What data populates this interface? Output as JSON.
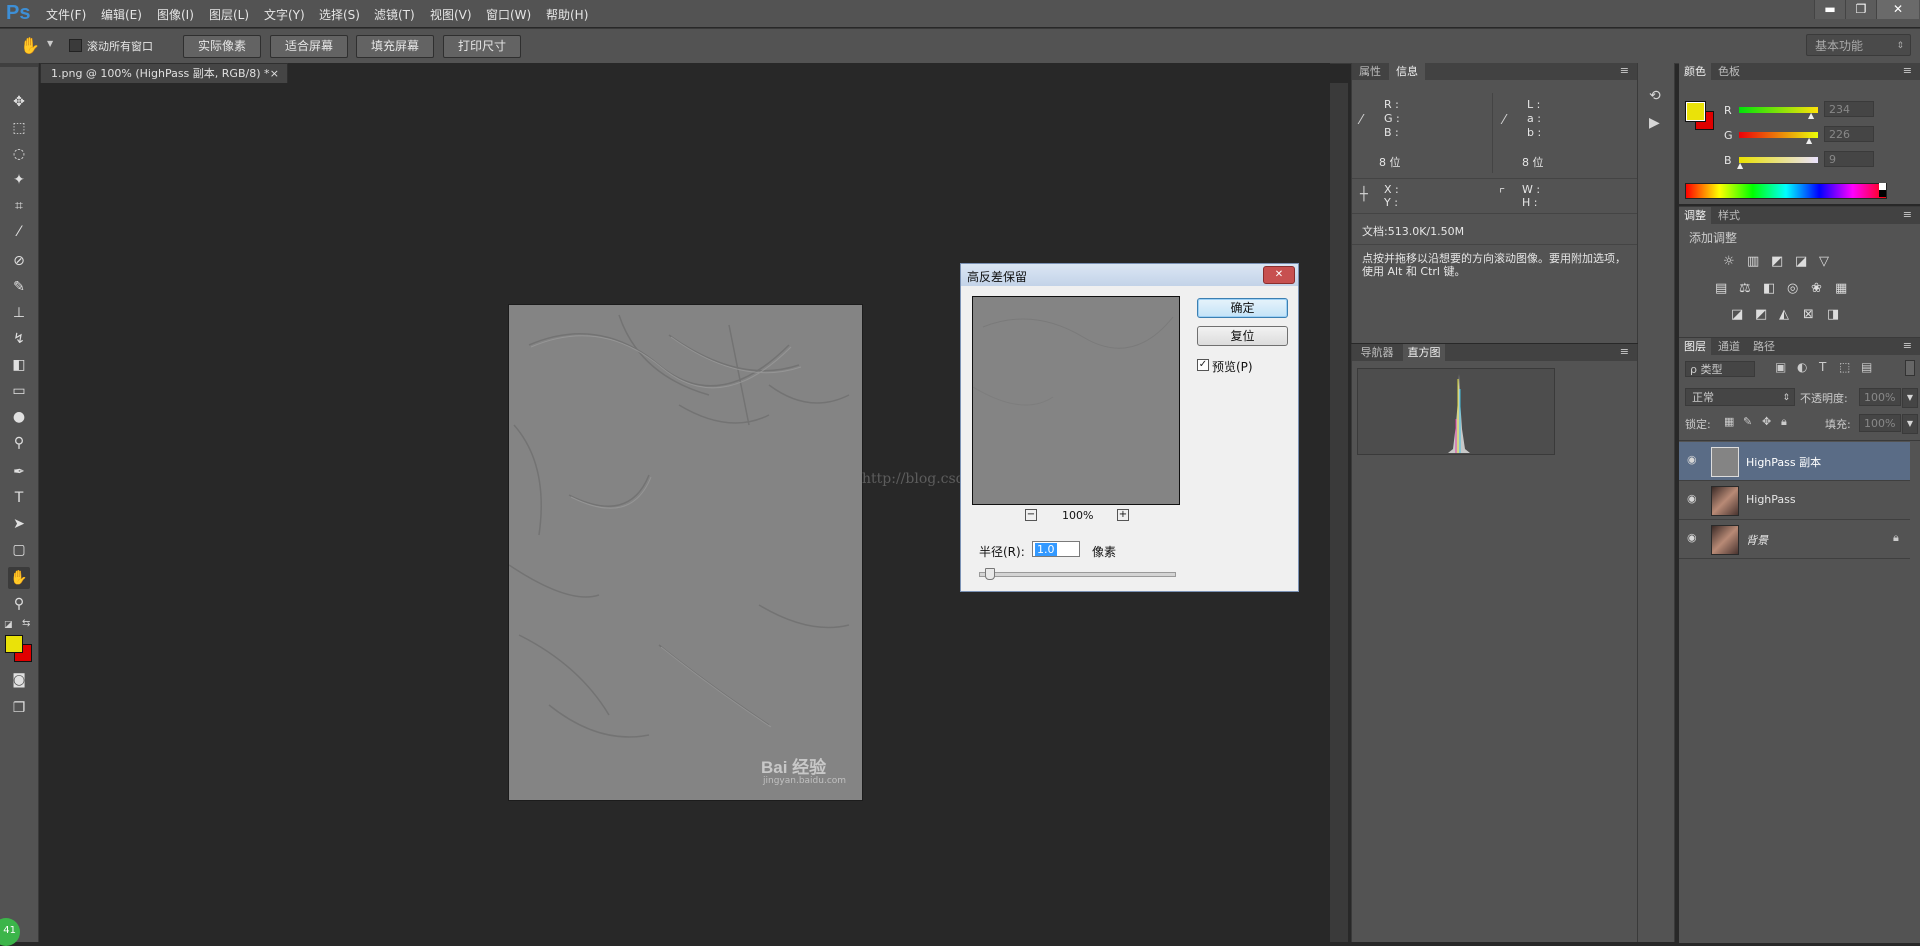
{
  "app": {
    "logo": "Ps"
  },
  "menu": [
    "文件(F)",
    "编辑(E)",
    "图像(I)",
    "图层(L)",
    "文字(Y)",
    "选择(S)",
    "滤镜(T)",
    "视图(V)",
    "窗口(W)",
    "帮助(H)"
  ],
  "window_controls": {
    "minimize": "▬",
    "restore": "❐",
    "close": "✕"
  },
  "options": {
    "scroll_all_label": "滚动所有窗口",
    "buttons": [
      "实际像素",
      "适合屏幕",
      "填充屏幕",
      "打印尺寸"
    ],
    "workspace": "基本功能"
  },
  "document_tab": {
    "title": "1.png @ 100% (HighPass 副本, RGB/8) *",
    "close": "×"
  },
  "watermark": {
    "logo": "Bai 经验",
    "url": "jingyan.baidu.com"
  },
  "blog_watermark": "http://blog.csdn.net/",
  "dialog": {
    "title": "高反差保留",
    "close": "✕",
    "ok": "确定",
    "reset": "复位",
    "preview_label": "预览(P)",
    "preview_checked": true,
    "zoom": "100%",
    "zoom_minus": "−",
    "zoom_plus": "+",
    "radius_label": "半径(R):",
    "radius_value": "1.0",
    "radius_unit": "像素",
    "radius_slider_level": 0.03
  },
  "info_panel": {
    "tabs": [
      "属性",
      "信息"
    ],
    "rgb_labels": [
      "R :",
      "G :",
      "B :"
    ],
    "lab_labels": [
      "L :",
      "a :",
      "b :"
    ],
    "bit_left": "8 位",
    "bit_right": "8 位",
    "xy_labels": [
      "X :",
      "Y :"
    ],
    "wh_labels": [
      "W :",
      "H :"
    ],
    "doc_size": "文档:513.0K/1.50M",
    "hint": "点按并拖移以沿想要的方向滚动图像。要用附加选项，使用 Alt 和 Ctrl 键。"
  },
  "nav_panel": {
    "tabs": [
      "导航器",
      "直方图"
    ]
  },
  "color_panel": {
    "tabs": [
      "颜色",
      "色板"
    ],
    "r": {
      "label": "R",
      "value": "234"
    },
    "g": {
      "label": "G",
      "value": "226"
    },
    "b": {
      "label": "B",
      "value": "9"
    },
    "foreground": "#eae209",
    "background": "#e00000"
  },
  "adjust_panel": {
    "tabs": [
      "调整",
      "样式"
    ],
    "add_label": "添加调整"
  },
  "layers_panel": {
    "tabs": [
      "图层",
      "通道",
      "路径"
    ],
    "filter": "ρ 类型",
    "blend_mode": "正常",
    "opacity_label": "不透明度:",
    "opacity_value": "100%",
    "lock_label": "锁定:",
    "fill_label": "填充:",
    "fill_value": "100%",
    "layers": [
      {
        "name": "HighPass 副本",
        "selected": true
      },
      {
        "name": "HighPass",
        "selected": false
      },
      {
        "name": "背景",
        "selected": false
      }
    ]
  },
  "corner_badge": "41"
}
